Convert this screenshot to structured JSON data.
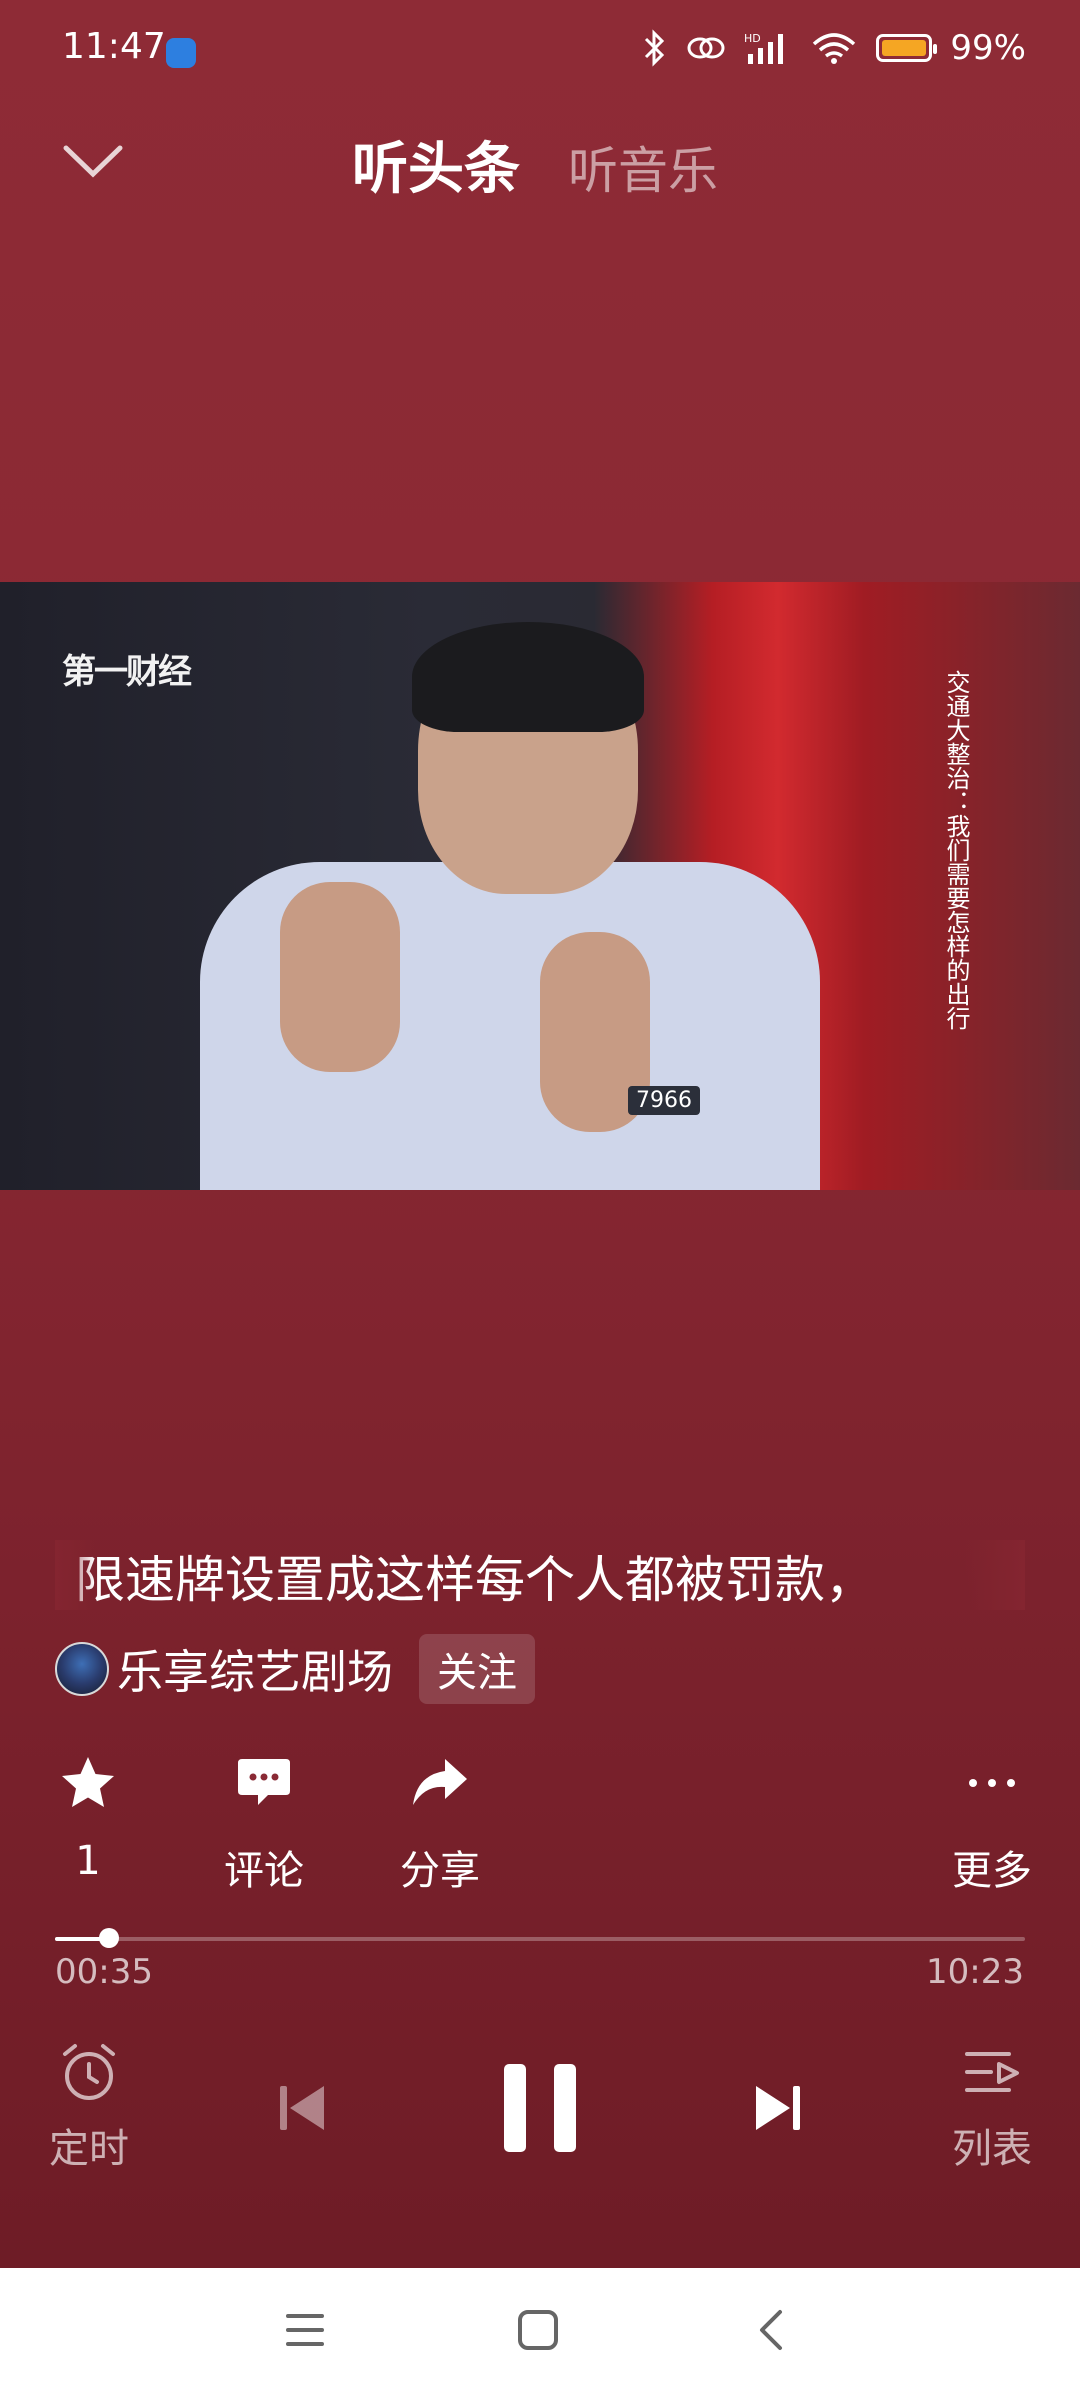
{
  "status_bar": {
    "time": "11:47",
    "battery_text": "99%",
    "battery_level": 0.99
  },
  "header": {
    "tab_news": "听头条",
    "tab_music": "听音乐"
  },
  "video": {
    "channel_logo": "第一财经",
    "side_caption": "交通大整治：我们需要怎样的出行",
    "badge_number": "7966"
  },
  "track": {
    "title": "：限速牌设置成这样每个人都被罚款，",
    "author": "乐享综艺剧场",
    "follow_label": "关注"
  },
  "actions": {
    "favorite_count": "1",
    "comment_label": "评论",
    "share_label": "分享",
    "more_label": "更多"
  },
  "progress": {
    "current": "00:35",
    "total": "10:23",
    "fraction": 0.056
  },
  "controls": {
    "timer_label": "定时",
    "playlist_label": "列表"
  }
}
